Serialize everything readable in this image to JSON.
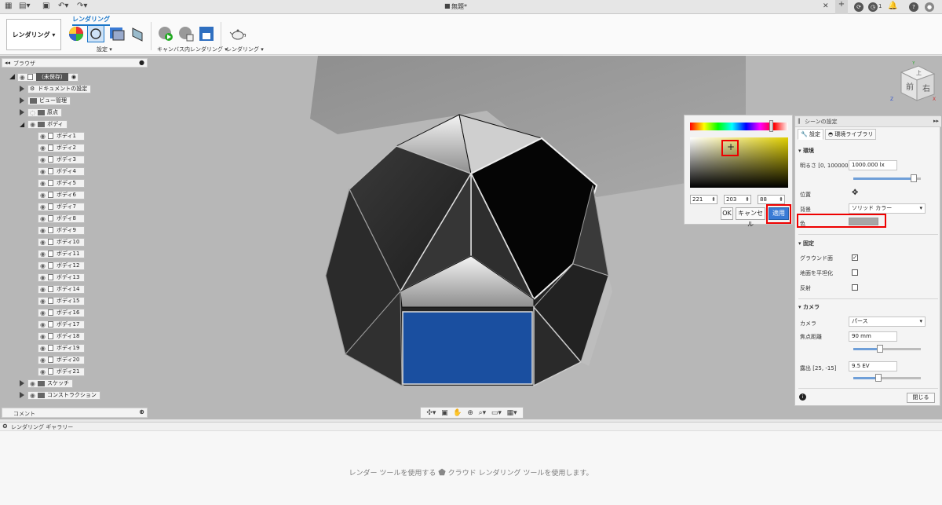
{
  "title_bar": {
    "document_title": "無題*",
    "notification_count": "1"
  },
  "ribbon": {
    "workspace": "レンダリング",
    "active_tab": "レンダリング",
    "groups": [
      {
        "label": "設定 ▾"
      },
      {
        "label": "キャンバス内レンダリング ▾"
      },
      {
        "label": "レンダリング ▾"
      }
    ]
  },
  "browser": {
    "header": "ブラウザ",
    "root": "（未保存）",
    "nodes": {
      "doc_settings": "ドキュメントの設定",
      "view_mgmt": "ビュー管理",
      "origin": "原点",
      "bodies": "ボディ",
      "sketch": "スケッチ",
      "construction": "コンストラクション"
    },
    "body_items": [
      "ボディ1",
      "ボディ2",
      "ボディ3",
      "ボディ4",
      "ボディ5",
      "ボディ6",
      "ボディ7",
      "ボディ8",
      "ボディ9",
      "ボディ10",
      "ボディ11",
      "ボディ12",
      "ボディ13",
      "ボディ14",
      "ボディ15",
      "ボディ16",
      "ボディ17",
      "ボディ18",
      "ボディ19",
      "ボディ20",
      "ボディ21"
    ]
  },
  "comments": {
    "label": "コメント"
  },
  "gallery": {
    "label": "レンダリング ギャラリー",
    "message_part1": "レンダー ツールを使用する",
    "message_part2": "クラウド レンダリング ツールを使用します。"
  },
  "color_picker": {
    "r": "221",
    "g": "203",
    "b": "88",
    "ok": "OK",
    "cancel": "キャンセル",
    "apply": "適用"
  },
  "scene_settings": {
    "title": "シーンの設定",
    "tabs": {
      "settings": "設定",
      "env_library": "環境ライブラリ"
    },
    "environment": {
      "header": "環境",
      "brightness_label": "明るさ [0, 100000]",
      "brightness_value": "1000.000 lx",
      "brightness_fraction": 0.9,
      "position_label": "位置",
      "background_label": "背景",
      "background_value": "ソリッド カラー",
      "color_label": "色"
    },
    "ground": {
      "header": "固定",
      "ground_plane": "グラウンド面",
      "ground_plane_checked": true,
      "flatten": "地面を平坦化",
      "flatten_checked": false,
      "reflection": "反射",
      "reflection_checked": false
    },
    "camera": {
      "header": "カメラ",
      "camera_label": "カメラ",
      "camera_value": "パース",
      "focal_label": "焦点距離",
      "focal_value": "90 mm",
      "focal_fraction": 0.4,
      "exposure_label": "露出 [25, -15]",
      "exposure_value": "9.5 EV",
      "exposure_fraction": 0.37
    },
    "close_label": "閉じる"
  },
  "view_cube": {
    "front": "前",
    "right": "右",
    "top": "上",
    "x": "X",
    "y": "Y",
    "z": "Z"
  },
  "colors": {
    "accent": "#1b77c9",
    "highlight": "#ee0000",
    "viewport_bg": "#b7b7b7",
    "blue_face": "#1a4fa0",
    "picked_color": "#ddcb58"
  }
}
